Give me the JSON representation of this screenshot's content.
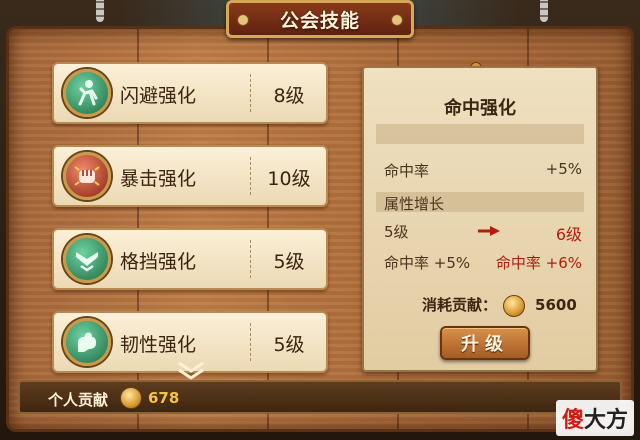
{
  "header": {
    "title": "公会技能"
  },
  "skills": [
    {
      "name": "闪避强化",
      "level": "8级",
      "icon": "dodge-icon",
      "color": "#2f8a5a"
    },
    {
      "name": "暴击强化",
      "level": "10级",
      "icon": "crit-fist-icon",
      "color": "#b4321e"
    },
    {
      "name": "格挡强化",
      "level": "5级",
      "icon": "block-icon",
      "color": "#2f8a5a"
    },
    {
      "name": "韧性强化",
      "level": "5级",
      "icon": "toughness-arm-icon",
      "color": "#2f8a5a"
    }
  ],
  "detail": {
    "title": "命中强化",
    "stat_label": "命中率",
    "stat_value": "+5%",
    "growth_label": "属性增长",
    "level_from": "5级",
    "level_to": "6级",
    "stat_from": "命中率 +5%",
    "stat_to": "命中率 +6%",
    "cost_label": "消耗贡献：",
    "cost_value": "5600",
    "upgrade_label": "升级"
  },
  "footer": {
    "label": "个人贡献",
    "value": "678"
  },
  "watermark": {
    "part1": "傻",
    "part2": "大方"
  },
  "colors": {
    "highlight": "#b01e0e",
    "gold": "#f3c34a"
  }
}
